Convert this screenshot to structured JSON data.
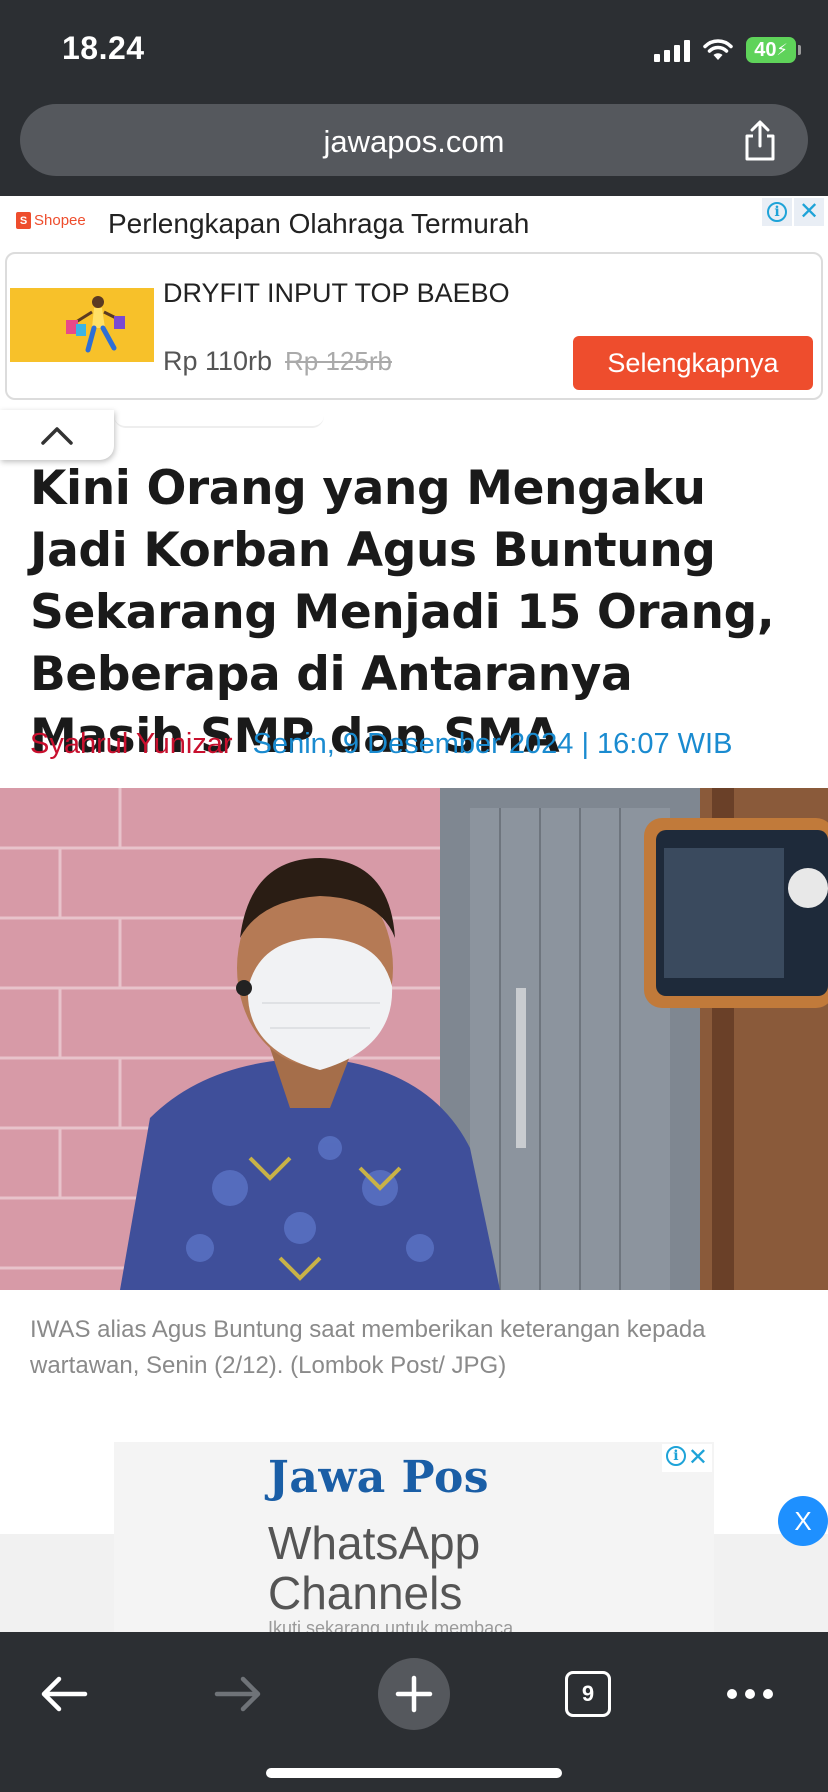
{
  "status_bar": {
    "time": "18.24",
    "battery": "40"
  },
  "browser": {
    "url": "jawapos.com",
    "open_tabs": "9"
  },
  "ad_banner": {
    "brand": "Shopee",
    "headline": "Perlengkapan Olahraga Termurah",
    "product": "DRYFIT INPUT TOP BAEBO",
    "price": "Rp 110rb",
    "old_price": "Rp 125rb",
    "cta": "Selengkapnya"
  },
  "article": {
    "title": "Kini Orang yang Mengaku Jadi Korban Agus Buntung Sekarang Menjadi 15 Orang, Beberapa di Antaranya Masih SMP dan SMA",
    "author": "Syahrul Yunizar",
    "date": "Senin, 9 Desember 2024 | 16:07 WIB",
    "caption": "IWAS alias Agus Buntung saat memberikan keterangan kepada wartawan, Senin (2/12). (Lombok Post/ JPG)"
  },
  "ad_bottom": {
    "brand": "Jawa Pos",
    "line1": "WhatsApp",
    "line2": "Channels",
    "small": "Ikuti sekarang untuk membaca",
    "close_label": "X"
  },
  "colors": {
    "chrome": "#2c2f33",
    "shopee": "#ee4d2d",
    "author": "#c8102e",
    "date": "#1a8bd0",
    "close_fab": "#1e90ff"
  }
}
